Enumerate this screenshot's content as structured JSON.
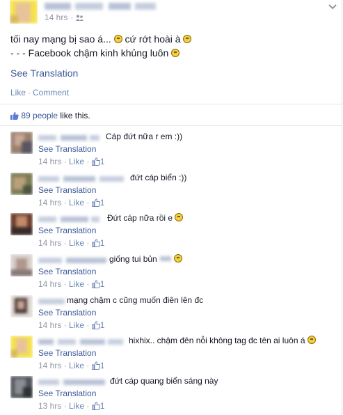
{
  "post": {
    "time": "14 hrs",
    "line1": "tối nay mạng bị sao á...",
    "line1b": "cứ rớt hoài à",
    "line2": "- - - Facebook chậm kinh khủng luôn",
    "see_translation": "See Translation",
    "like": "Like",
    "comment": "Comment",
    "likes_count": "89 people",
    "likes_suffix": "like this."
  },
  "comments": [
    {
      "text": "Cáp đứt nữa r em :))",
      "see": "See Translation",
      "time": "14 hrs",
      "like": "Like",
      "likes": "1"
    },
    {
      "text": "đứt cáp biển :))",
      "see": "See Translation",
      "time": "14 hrs",
      "like": "Like",
      "likes": "1"
    },
    {
      "text": "Đứt cáp nữa rồi e",
      "see": "See Translation",
      "time": "14 hrs",
      "like": "Like",
      "likes": "1"
    },
    {
      "text": "giống tui bủn",
      "see": "See Translation",
      "time": "14 hrs",
      "like": "Like",
      "likes": "1"
    },
    {
      "text": "mạng chậm c cũng muốn điên lên đc",
      "see": "See Translation",
      "time": "14 hrs",
      "like": "Like",
      "likes": "1"
    },
    {
      "text": "hixhix.. chậm đên nỗi không tag đc tên ai luôn á",
      "see": "See Translation",
      "time": "14 hrs",
      "like": "Like",
      "likes": "1"
    },
    {
      "text": "đứt cáp quang biển sáng này",
      "see": "See Translation",
      "time": "13 hrs",
      "like": "Like",
      "likes": "1"
    }
  ]
}
